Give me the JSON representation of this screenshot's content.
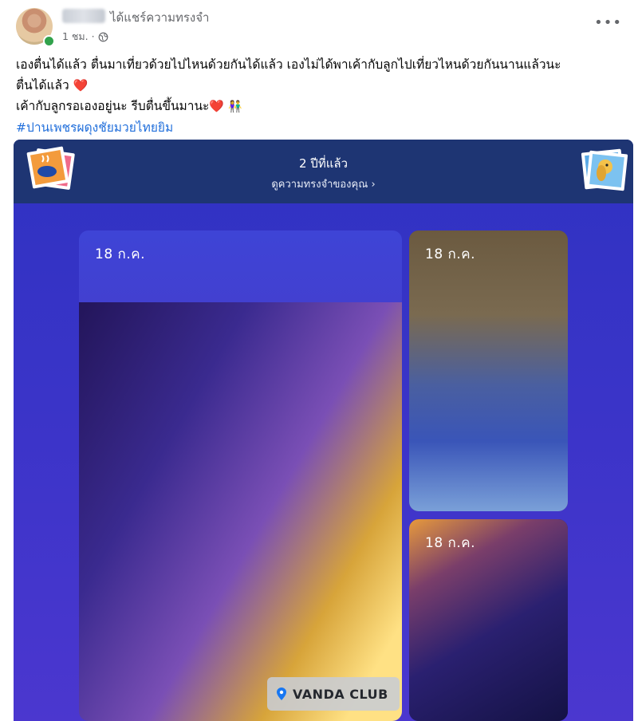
{
  "header": {
    "action": "ได้แชร์ความทรงจำ",
    "time": "1 ชม. ·",
    "more": "•••"
  },
  "post": {
    "line1": "เองตื่นได้แล้ว  ตื่นมาเที่ยวด้วยไปไหนด้วยกันได้แล้ว  เองไม่ได้พาเค้ากับลูกไปเที่ยวไหนด้วยกันนานแล้วนะ",
    "line2": "ตื่นได้แล้ว",
    "line3": "เค้ากับลูกรอเองอยู่นะ รีบตื่นขึ้นมานะ",
    "hashtag": "#ปานเพชรผดุงชัยมวยไทยยิม",
    "heart": "❤️",
    "couple": "👫"
  },
  "memory": {
    "years_ago": "2 ปีที่แล้ว",
    "see_memories": "ดูความทรงจำของคุณ",
    "chevron": "›",
    "photos": [
      {
        "date": "18 ก.ค."
      },
      {
        "date": "18 ก.ค."
      },
      {
        "date": "18 ก.ค."
      }
    ],
    "location": "VANDA CLUB"
  }
}
